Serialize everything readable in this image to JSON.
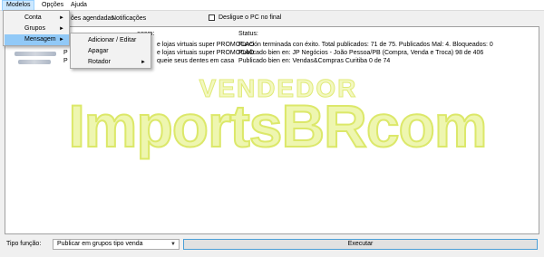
{
  "menubar": {
    "items": [
      "Modelos",
      "Opções",
      "Ajuda"
    ]
  },
  "tabs": {
    "scheduled": "ões agendadas",
    "notifications": "Notificações"
  },
  "shutdown_label": "Desligue o PC no final",
  "columns": {
    "message": "agem:",
    "status": "Status:"
  },
  "rows": [
    {
      "left": "os06874... ",
      "prefix": "P",
      "message": "e lojas virtuais super PROMOCAO",
      "status": "Función terminada con éxito. Total publicados: 71 de 75. Publicados Mal: 4. Bloqueados: 0"
    },
    {
      "left": "",
      "prefix": "P",
      "message": "e lojas virtuais super PROMOCAO",
      "status": "Publicado bien en: JP Negócios - João Pessoa/PB (Compra, Venda e Troca) 98 de 406"
    },
    {
      "left": "",
      "prefix": "P",
      "message": "queie seus dentes em casa",
      "status": "Publicado bien en: Vendas&Compras Curitiba 0 de 74"
    }
  ],
  "watermark": {
    "top": "VENDEDOR",
    "main": "ImportsBRcom"
  },
  "menu_modelos": {
    "items": [
      {
        "label": "Conta",
        "arrow": "►"
      },
      {
        "label": "Grupos",
        "arrow": "►"
      },
      {
        "label": "Mensagem",
        "arrow": "►"
      }
    ]
  },
  "menu_mensagem": {
    "items": [
      {
        "label": "Adicionar / Editar",
        "arrow": ""
      },
      {
        "label": "Apagar",
        "arrow": ""
      },
      {
        "label": "Rotador",
        "arrow": "►"
      }
    ]
  },
  "bottom": {
    "label": "Tipo função:",
    "select_value": "Publicar em grupos tipo venda",
    "execute": "Executar"
  },
  "colors": {
    "highlight": "#91c9f7",
    "watermark": "#eef6b0",
    "exec_border": "#4c9fd6"
  }
}
